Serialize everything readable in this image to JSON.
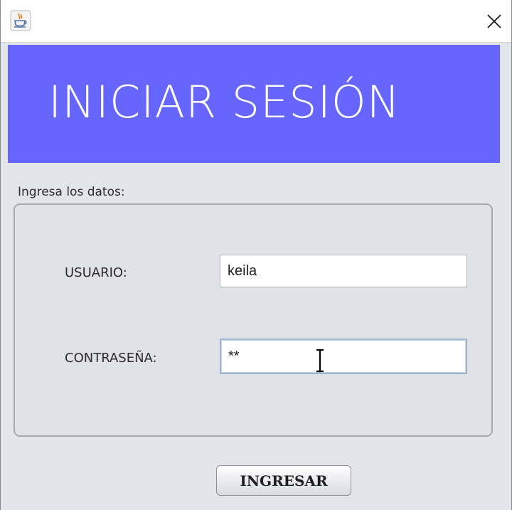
{
  "window": {
    "app_icon": "java-coffee-icon",
    "close_icon": "close-icon"
  },
  "banner": {
    "title": "INICIAR SESIÓN",
    "background_color": "#6666ff",
    "text_color": "#ffffff"
  },
  "form": {
    "section_label": "Ingresa los datos:",
    "username_label": "USUARIO:",
    "username_value": "keila",
    "password_label": "CONTRASEÑA:",
    "password_value": "**",
    "submit_label": "INGRESAR"
  },
  "cursor_icon": "text-cursor-icon"
}
